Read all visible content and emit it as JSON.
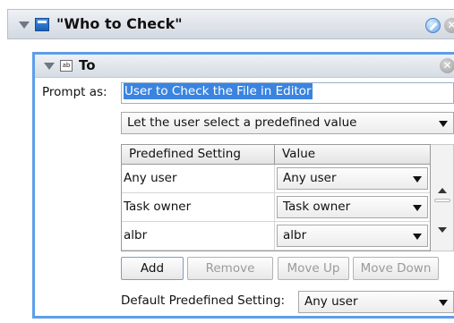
{
  "action": {
    "title": "\"Who to Check\"",
    "icons": [
      "disclosure-triangle-icon",
      "action-box-icon",
      "edit-icon",
      "close-icon"
    ]
  },
  "field": {
    "title": "To",
    "icon_text": "ab",
    "prompt_label": "Prompt as:",
    "prompt_value": "User to Check the File in Editor",
    "mode_selected": "Let the user select a predefined value",
    "table": {
      "columns": [
        "Predefined Setting",
        "Value"
      ],
      "rows": [
        {
          "setting": "Any user",
          "value": "Any user"
        },
        {
          "setting": "Task owner",
          "value": "Task owner"
        },
        {
          "setting": "albr",
          "value": "albr"
        }
      ]
    },
    "buttons": {
      "add": "Add",
      "remove": "Remove",
      "move_up": "Move Up",
      "move_down": "Move Down"
    },
    "default_label": "Default Predefined Setting:",
    "default_value": "Any user"
  },
  "colors": {
    "selection": "#3a84e0",
    "panel_border": "#5d9ee9",
    "disabled_text": "#9b9b9b"
  }
}
